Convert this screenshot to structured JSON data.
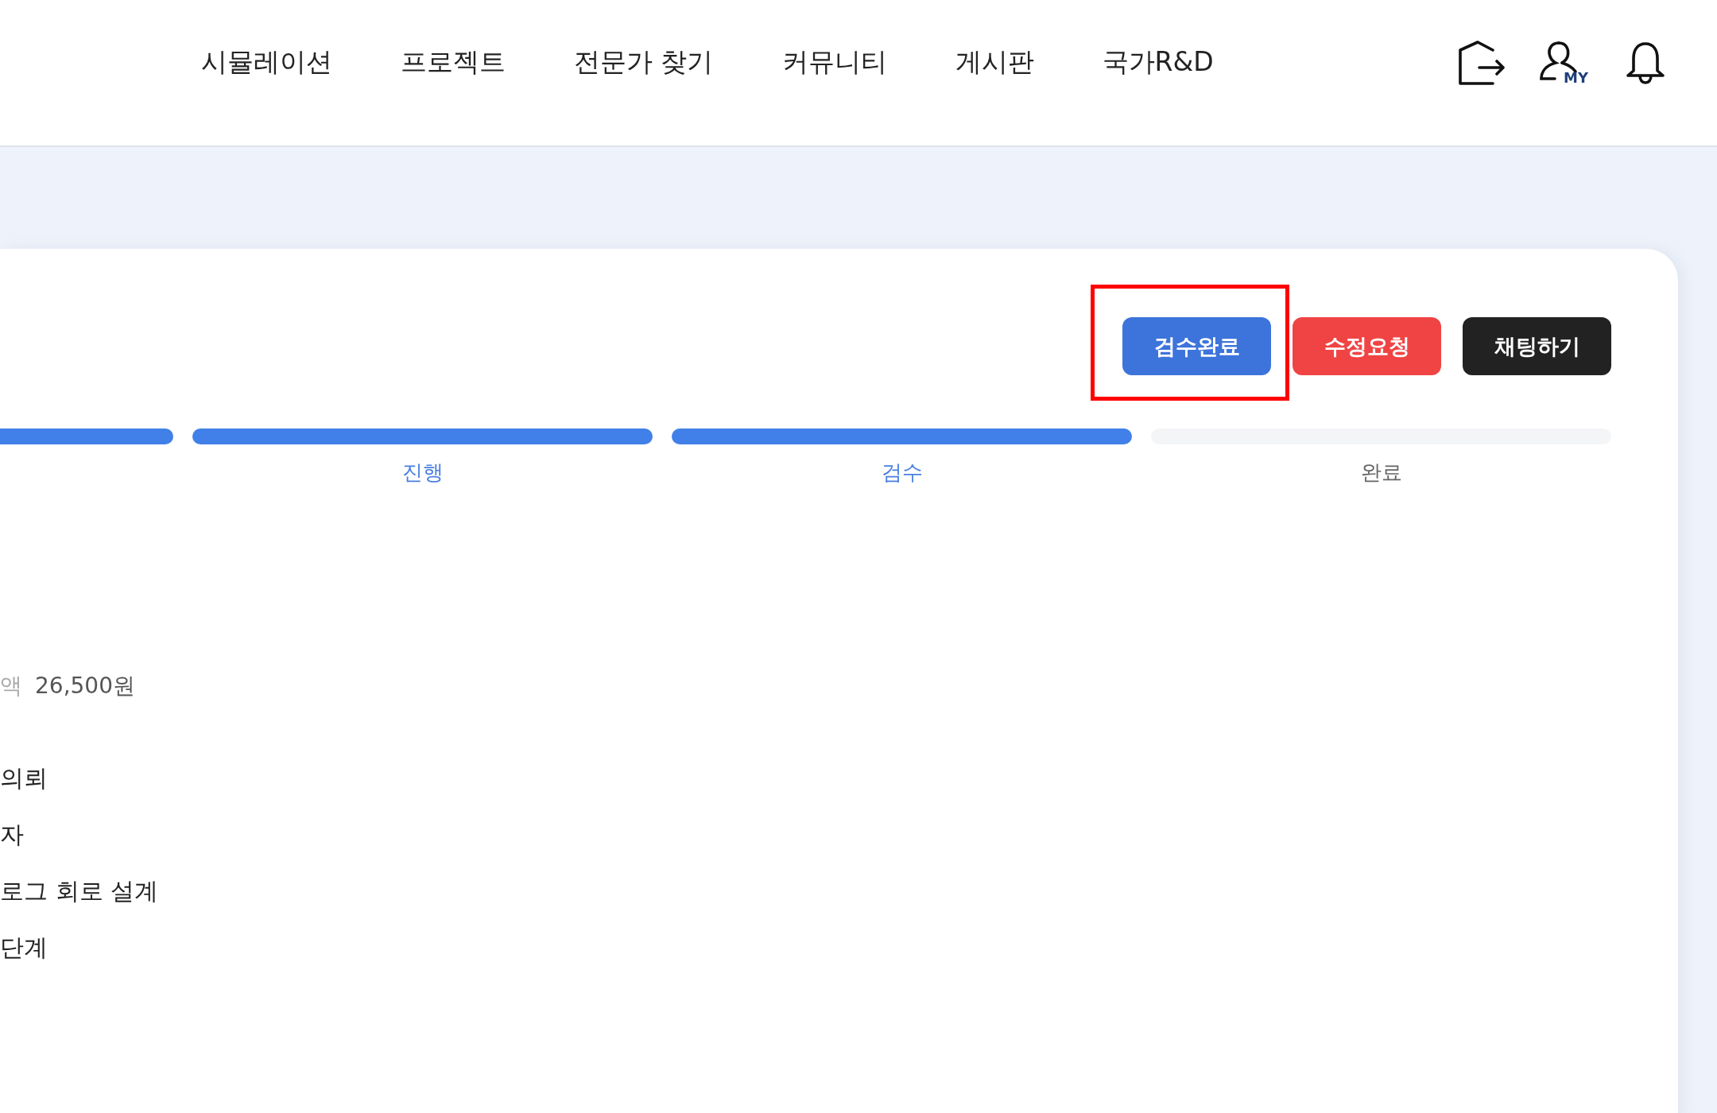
{
  "nav": {
    "items": [
      "시뮬레이션",
      "프로젝트",
      "전문가 찾기",
      "커뮤니티",
      "게시판",
      "국가R&D"
    ]
  },
  "header": {
    "my_badge": "MY"
  },
  "buttons": [
    {
      "label": "검수완료",
      "kind": "primary",
      "highlighted": true
    },
    {
      "label": "수정요청",
      "kind": "danger",
      "highlighted": false
    },
    {
      "label": "채팅하기",
      "kind": "dark",
      "highlighted": false
    }
  ],
  "progress": {
    "steps": [
      {
        "done": true
      },
      {
        "label": "진행",
        "done": true
      },
      {
        "label": "검수",
        "done": true
      },
      {
        "label": "완료",
        "done": false
      }
    ]
  },
  "price": {
    "label": "액",
    "value": "26,500원"
  },
  "details": [
    "의뢰",
    "자",
    "로그 회로 설계",
    "단계"
  ]
}
